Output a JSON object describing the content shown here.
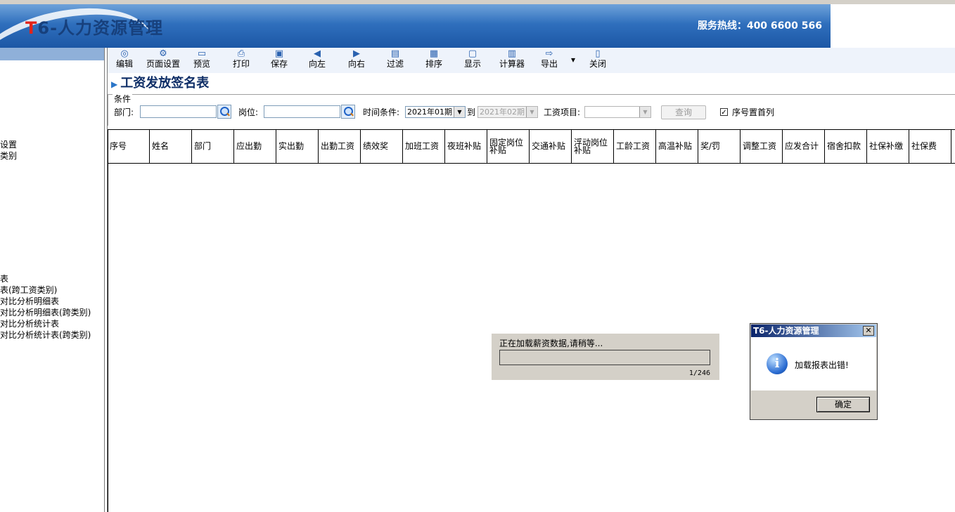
{
  "banner": {
    "logo_t": "T",
    "logo_rest": "6-人力资源管理",
    "hotline": "服务热线：400 6600 566"
  },
  "leftnav": {
    "items": [
      {
        "label": "设置"
      },
      {
        "label": "类别"
      },
      {
        "label": "表"
      },
      {
        "label": "表(跨工资类别)"
      },
      {
        "label": "对比分析明细表"
      },
      {
        "label": "对比分析明细表(跨类别)"
      },
      {
        "label": "对比分析统计表"
      },
      {
        "label": "对比分析统计表(跨类别)"
      }
    ]
  },
  "toolbar": {
    "items": [
      {
        "label": "编辑",
        "icon": "edit-icon",
        "glyph": "◎"
      },
      {
        "label": "页面设置",
        "icon": "page-setup-icon",
        "glyph": "⚙"
      },
      {
        "label": "预览",
        "icon": "preview-icon",
        "glyph": "▭"
      },
      {
        "label": "打印",
        "icon": "print-icon",
        "glyph": "⎙"
      },
      {
        "label": "保存",
        "icon": "save-icon",
        "glyph": "▣"
      },
      {
        "label": "向左",
        "icon": "arrow-left-icon",
        "glyph": "◀"
      },
      {
        "label": "向右",
        "icon": "arrow-right-icon",
        "glyph": "▶"
      },
      {
        "label": "过滤",
        "icon": "filter-icon",
        "glyph": "▤"
      },
      {
        "label": "排序",
        "icon": "sort-icon",
        "glyph": "▦"
      },
      {
        "label": "显示",
        "icon": "display-icon",
        "glyph": "▢"
      },
      {
        "label": "计算器",
        "icon": "calculator-icon",
        "glyph": "▥"
      },
      {
        "label": "导出",
        "icon": "export-icon",
        "glyph": "⇨"
      },
      {
        "label": "关闭",
        "icon": "close-book-icon",
        "glyph": "▯"
      }
    ],
    "export_dropdown_glyph": "▾"
  },
  "page": {
    "title": "工资发放签名表"
  },
  "conditions": {
    "legend": "条件",
    "dept_label": "部门:",
    "dept_value": "",
    "post_label": "岗位:",
    "post_value": "",
    "time_label": "时间条件:",
    "period_from": "2021年01期",
    "to_label": "到",
    "period_to": "2021年02期",
    "item_label": "工资项目:",
    "item_value": "",
    "query_label": "查询",
    "seq_first_label": "序号置首列",
    "seq_first_checked": true,
    "checkbox_glyph": "✓"
  },
  "grid": {
    "columns": [
      "序号",
      "姓名",
      "部门",
      "应出勤",
      "实出勤",
      "出勤工资",
      "绩效奖",
      "加班工资",
      "夜班补贴",
      "固定岗位补贴",
      "交通补贴",
      "浮动岗位补贴",
      "工龄工资",
      "高温补贴",
      "奖/罚",
      "调整工资",
      "应发合计",
      "宿舍扣款",
      "社保补缴",
      "社保费"
    ]
  },
  "progress": {
    "message": "正在加载薪资数据,请稍等...",
    "count": "1/246"
  },
  "dialog": {
    "title": "T6-人力资源管理",
    "close_glyph": "✕",
    "icon_glyph": "i",
    "message": "加载报表出错!",
    "ok_label": "确定"
  }
}
